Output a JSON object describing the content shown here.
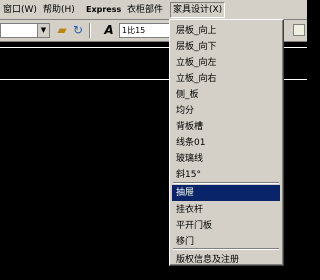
{
  "menubar": {
    "items": [
      "窗口(W)",
      "帮助(H)",
      "Express",
      "衣柜部件",
      "家具设计(X)"
    ]
  },
  "toolbar": {
    "text_style_value": "1比15",
    "text_style_icon": "A",
    "folder_icon": "folder-icon",
    "refresh_icon": "refresh-icon"
  },
  "menu": {
    "items": [
      "层板_向上",
      "层板_向下",
      "立板_向左",
      "立板_向右",
      "侧_板",
      "均分",
      "背板槽",
      "线条01",
      "玻璃线",
      "斜15°",
      "抽屉",
      "挂衣杆",
      "平开门板",
      "移门",
      "版权信息及注册"
    ],
    "highlighted": "抽屉"
  },
  "colors": {
    "menu_bg": "#d4d0c8",
    "highlight": "#0a246a",
    "canvas": "#000000"
  }
}
